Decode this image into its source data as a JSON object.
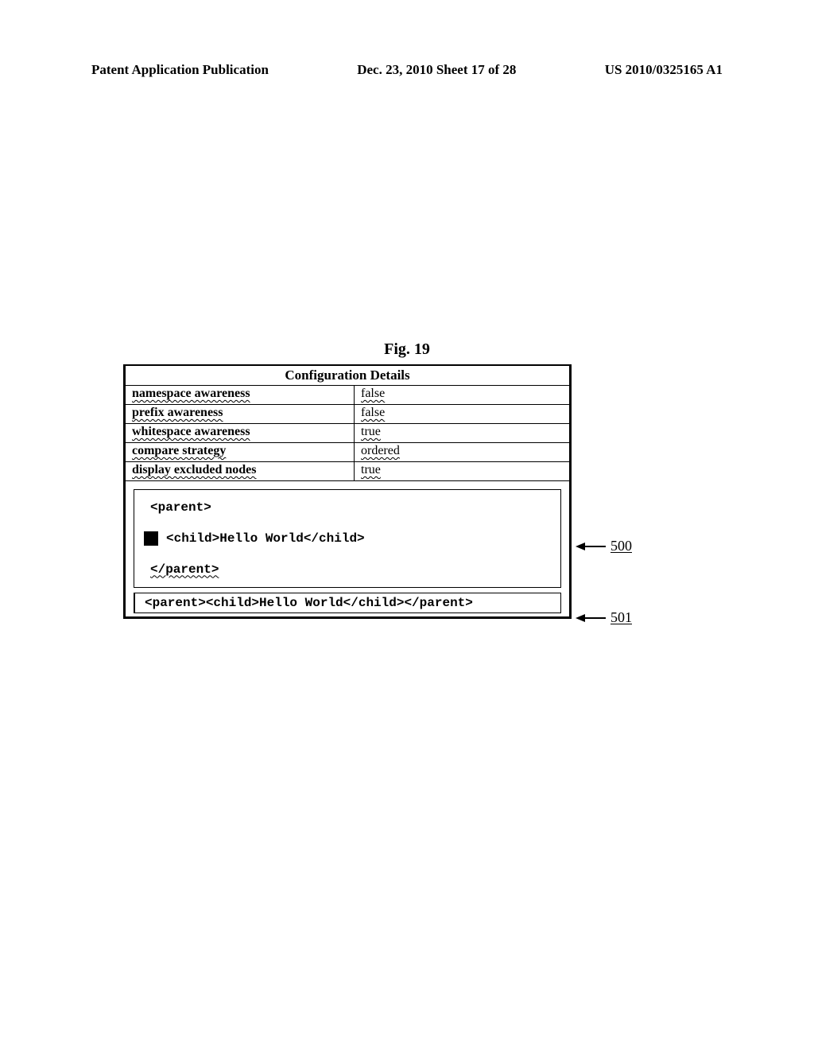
{
  "header": {
    "left": "Patent Application Publication",
    "center": "Dec. 23, 2010  Sheet 17 of 28",
    "right": "US 2010/0325165 A1"
  },
  "figure_label": "Fig. 19",
  "config": {
    "title": "Configuration Details",
    "rows": [
      {
        "key": "namespace awareness",
        "val": "false"
      },
      {
        "key": "prefix awareness",
        "val": "false"
      },
      {
        "key": "whitespace awareness",
        "val": "true"
      },
      {
        "key": "compare strategy",
        "val": "ordered"
      },
      {
        "key": "display excluded nodes",
        "val": "true"
      }
    ]
  },
  "code1": {
    "l1": "<parent>",
    "l2": "<child>Hello World</child>",
    "l3": "</parent>"
  },
  "code2": "<parent><child>Hello World</child></parent>",
  "refs": {
    "a": "500",
    "b": "501"
  }
}
